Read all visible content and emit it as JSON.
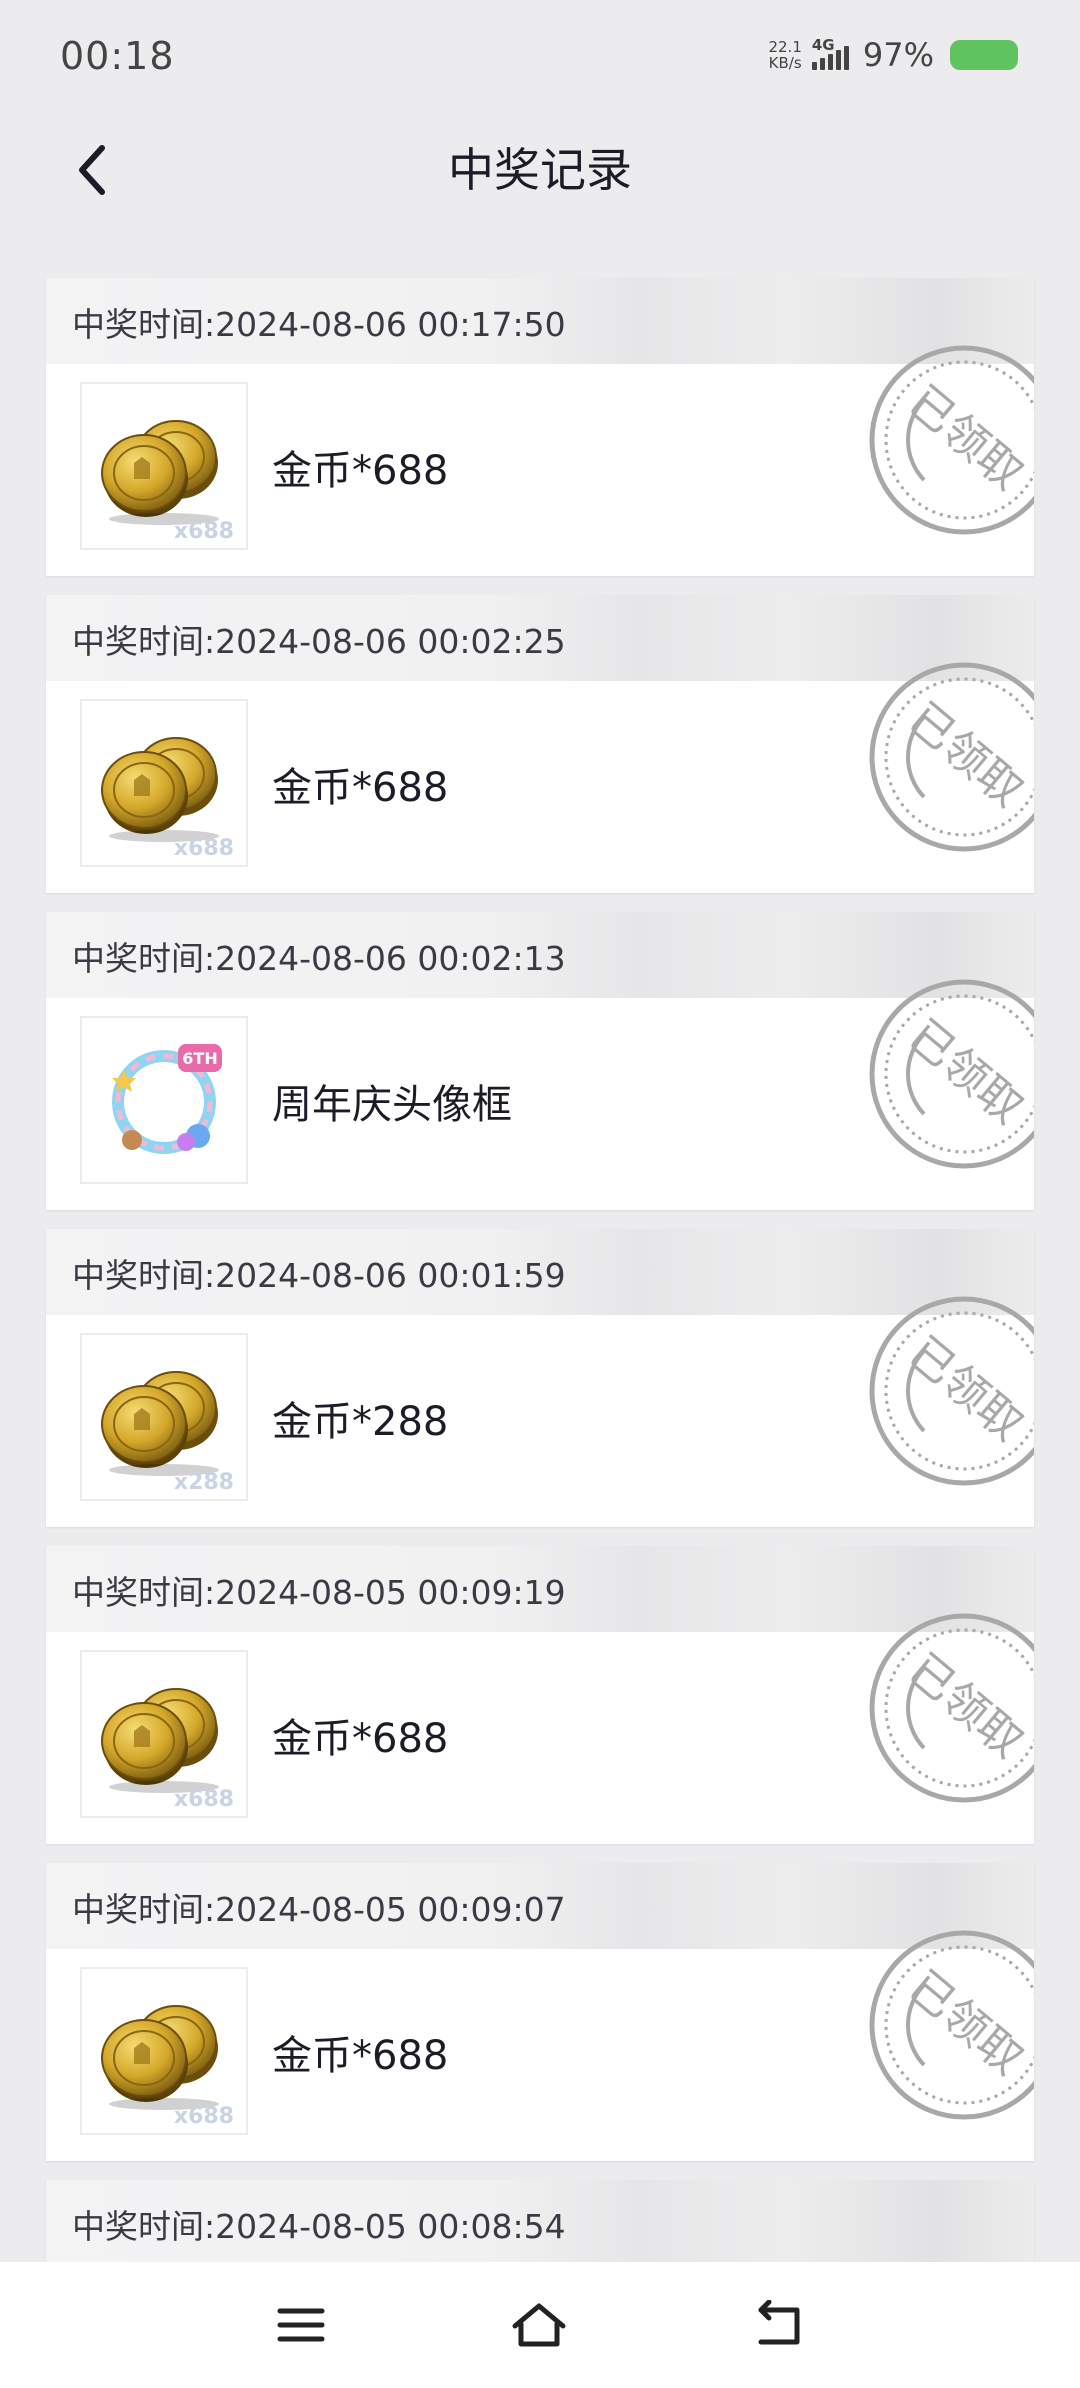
{
  "status": {
    "time": "00:18",
    "net_speed_value": "22.1",
    "net_speed_unit": "KB/s",
    "network": "4G",
    "battery": "97%",
    "battery_color": "#5fc45f"
  },
  "header": {
    "title": "中奖记录"
  },
  "records": [
    {
      "time": "中奖时间:2024-08-06 00:17:50",
      "name": "金币*688",
      "qty": "x688",
      "icon": "gold-coins-icon",
      "stamp": "已领取"
    },
    {
      "time": "中奖时间:2024-08-06 00:02:25",
      "name": "金币*688",
      "qty": "x688",
      "icon": "gold-coins-icon",
      "stamp": "已领取"
    },
    {
      "time": "中奖时间:2024-08-06 00:02:13",
      "name": "周年庆头像框",
      "qty": "",
      "icon": "avatar-frame-icon",
      "stamp": "已领取"
    },
    {
      "time": "中奖时间:2024-08-06 00:01:59",
      "name": "金币*288",
      "qty": "x288",
      "icon": "gold-coins-icon",
      "stamp": "已领取"
    },
    {
      "time": "中奖时间:2024-08-05 00:09:19",
      "name": "金币*688",
      "qty": "x688",
      "icon": "gold-coins-icon",
      "stamp": "已领取"
    },
    {
      "time": "中奖时间:2024-08-05 00:09:07",
      "name": "金币*688",
      "qty": "x688",
      "icon": "gold-coins-icon",
      "stamp": "已领取"
    },
    {
      "time": "中奖时间:2024-08-05 00:08:54"
    }
  ],
  "frame_badge": "6TH",
  "colors": {
    "background": "#ececee",
    "card": "#ffffff",
    "stamp": "#a8a8a8",
    "coin_gold": "#d4a82a"
  }
}
